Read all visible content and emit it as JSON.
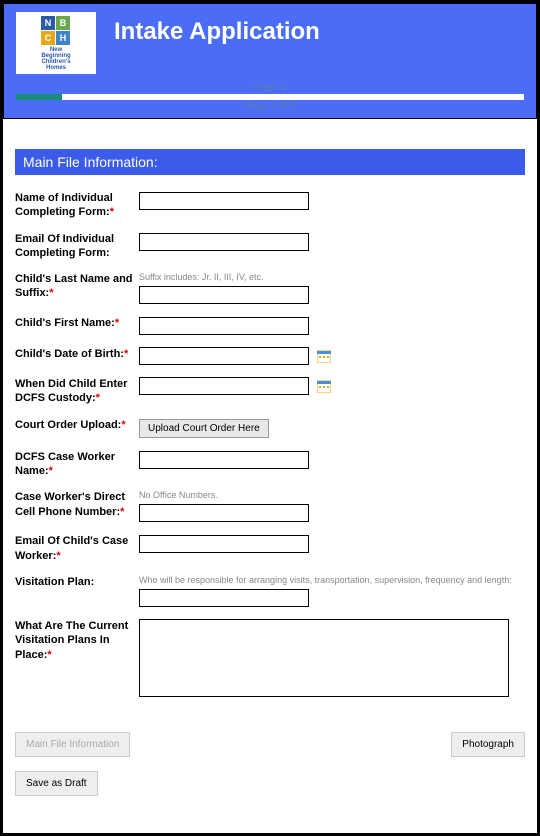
{
  "header": {
    "title": "Intake Application",
    "logo_text_line1": "New",
    "logo_text_line2": "Beginning",
    "logo_text_line3": "Children's",
    "logo_text_line4": "Homes",
    "progress_top": "Page 1",
    "progress_bottom": "Page 1 of 8"
  },
  "section": {
    "title": "Main File Information:"
  },
  "fields": {
    "name_completing": {
      "label": "Name of Individual Completing Form:",
      "value": ""
    },
    "email_completing": {
      "label": "Email Of Individual Completing Form:",
      "value": ""
    },
    "child_last": {
      "label": "Child's Last Name and Suffix:",
      "hint": "Suffix includes: Jr. II, III, IV, etc.",
      "value": ""
    },
    "child_first": {
      "label": "Child's First Name:",
      "value": ""
    },
    "child_dob": {
      "label": "Child's Date of Birth:",
      "value": ""
    },
    "dcfs_entry": {
      "label": "When Did Child Enter DCFS Custody:",
      "value": ""
    },
    "court_upload": {
      "label": "Court Order Upload:",
      "button": "Upload Court Order Here"
    },
    "case_worker_name": {
      "label": "DCFS Case Worker Name:",
      "value": ""
    },
    "case_worker_cell": {
      "label": "Case Worker's Direct Cell Phone Number:",
      "hint": "No Office Numbers.",
      "value": ""
    },
    "case_worker_email": {
      "label": "Email Of Child's Case Worker:",
      "value": ""
    },
    "visitation_plan": {
      "label": "Visitation Plan:",
      "hint": "Who will be responsible for arranging visits, transportation, supervision, frequency and length:",
      "value": ""
    },
    "visitation_current": {
      "label": "What Are The Current Visitation Plans In Place:",
      "value": ""
    }
  },
  "nav": {
    "prev": "Main File Information",
    "next": "Photograph",
    "save": "Save as Draft"
  }
}
